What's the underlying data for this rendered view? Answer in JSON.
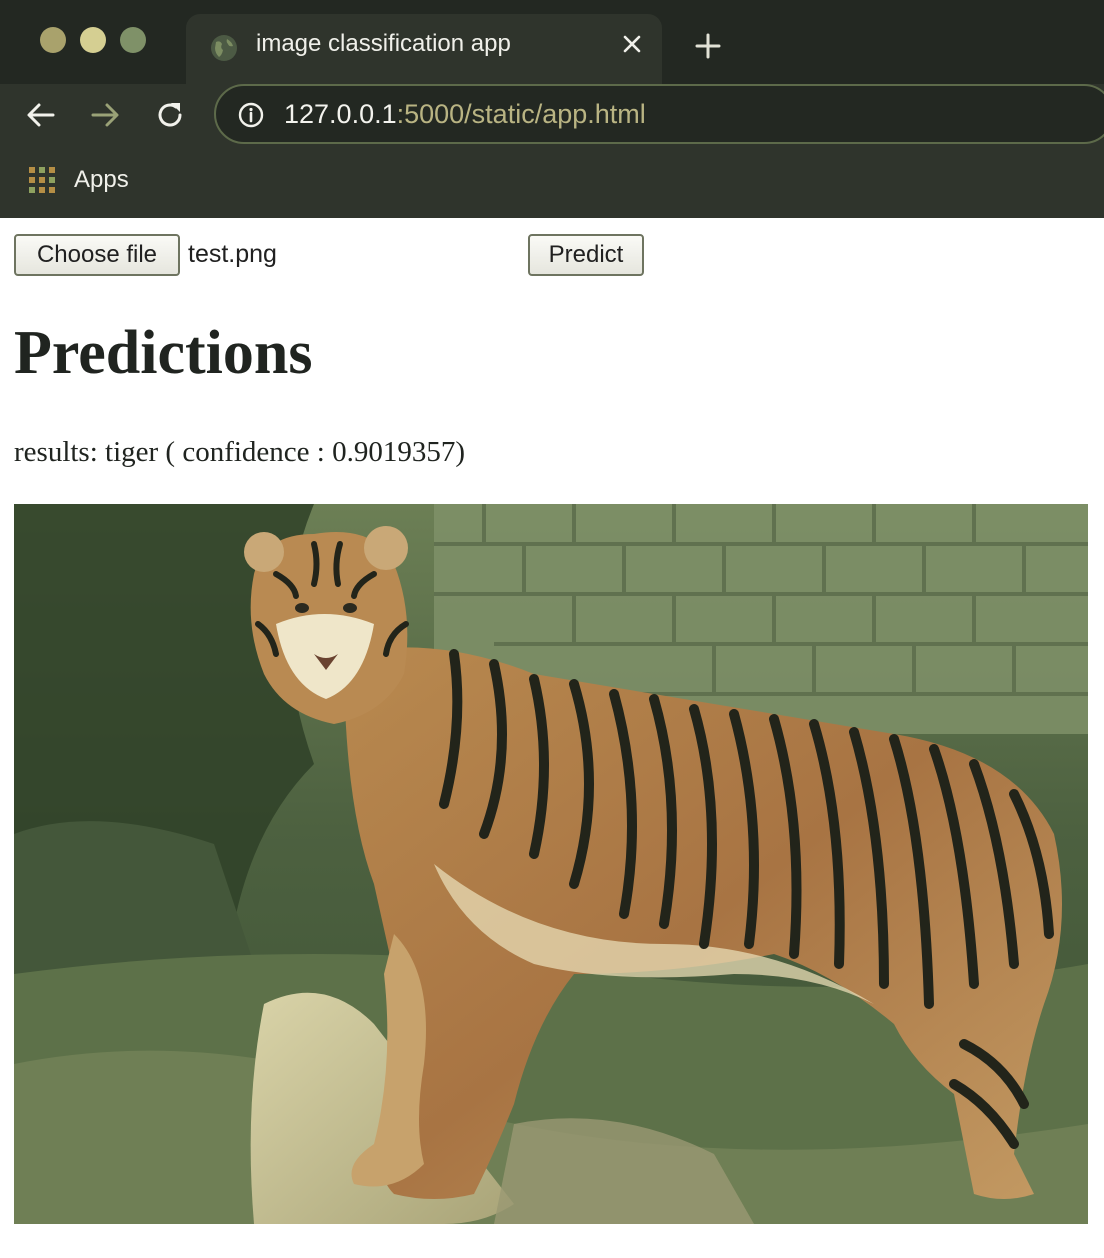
{
  "browser": {
    "tab_title": "image classification app",
    "url_host": "127.0.0.1",
    "url_rest": ":5000/static/app.html",
    "bookmark_apps": "Apps",
    "traffic_lights": [
      "#a9a26c",
      "#d5cf92",
      "#7f9168"
    ]
  },
  "page": {
    "file_button": "Choose file",
    "file_name": "test.png",
    "predict_button": "Predict",
    "heading": "Predictions",
    "results_text": "results: tiger ( confidence : 0.9019357)"
  },
  "icons": {
    "tab": "globe-icon",
    "close": "close-icon",
    "new_tab": "plus-icon",
    "back": "arrow-left-icon",
    "forward": "arrow-right-icon",
    "reload": "reload-icon",
    "site_info": "info-icon",
    "apps": "apps-grid-icon"
  }
}
